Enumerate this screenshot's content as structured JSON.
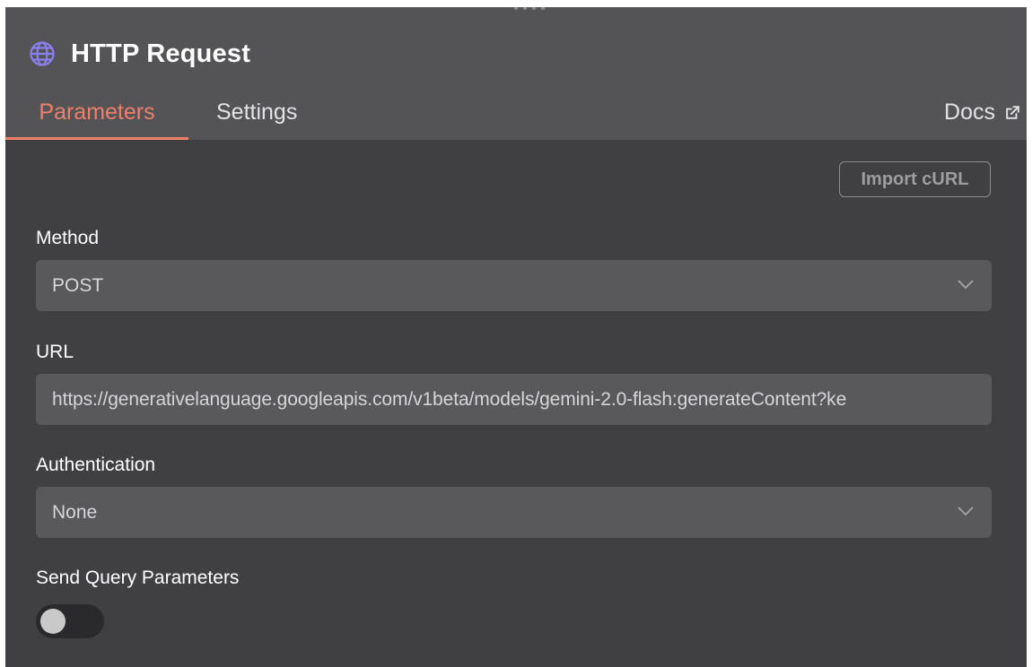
{
  "node": {
    "title": "HTTP Request",
    "icon": "globe-icon",
    "accent_color": "#8b7ff0"
  },
  "tabs": [
    {
      "label": "Parameters",
      "active": true
    },
    {
      "label": "Settings",
      "active": false
    }
  ],
  "docs": {
    "label": "Docs",
    "icon": "external-link-icon"
  },
  "import_button": {
    "label": "Import cURL"
  },
  "fields": {
    "method": {
      "label": "Method",
      "value": "POST"
    },
    "url": {
      "label": "URL",
      "value": "https://generativelanguage.googleapis.com/v1beta/models/gemini-2.0-flash:generateContent?ke"
    },
    "authentication": {
      "label": "Authentication",
      "value": "None"
    },
    "send_query": {
      "label": "Send Query Parameters",
      "enabled": false
    }
  },
  "colors": {
    "active_tab": "#f07f6a",
    "panel_bg": "#404042",
    "header_bg": "#545456",
    "field_bg": "#59595b"
  }
}
